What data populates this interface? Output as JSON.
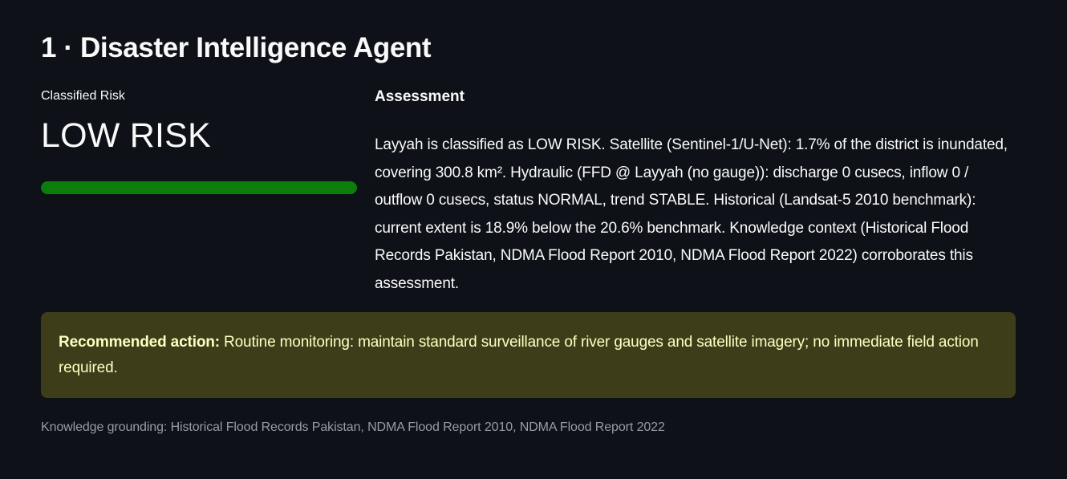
{
  "section": {
    "title": "1 · Disaster Intelligence Agent"
  },
  "metric": {
    "label": "Classified Risk",
    "value": "LOW RISK",
    "progress_fraction": 1.0,
    "progress_color": "#0b7d0b"
  },
  "assessment": {
    "heading": "Assessment",
    "text": "Layyah is classified as LOW RISK. Satellite (Sentinel-1/U-Net): 1.7% of the district is inundated, covering 300.8 km². Hydraulic (FFD @ Layyah (no gauge)): discharge 0 cusecs, inflow 0 / outflow 0 cusecs, status NORMAL, trend STABLE. Historical (Landsat-5 2010 benchmark): current extent is 18.9% below the 20.6% benchmark. Knowledge context (Historical Flood Records Pakistan, NDMA Flood Report 2010, NDMA Flood Report 2022) corroborates this assessment."
  },
  "recommendation": {
    "label": "Recommended action:",
    "text": " Routine monitoring: maintain standard surveillance of river gauges and satellite imagery; no immediate field action required."
  },
  "caption": {
    "text": "Knowledge grounding: Historical Flood Records Pakistan, NDMA Flood Report 2010, NDMA Flood Report 2022"
  },
  "colors": {
    "background": "#0e1117",
    "callout_background": "#3d3e19",
    "callout_text": "#ffffc2",
    "caption_text": "#9a9ca4"
  }
}
